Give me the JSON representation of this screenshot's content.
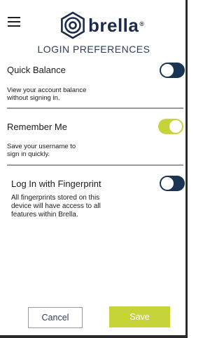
{
  "header": {
    "logo_text": "brella",
    "logo_tm": "®",
    "title": "LOGIN PREFERENCES"
  },
  "settings": [
    {
      "title": "Quick Balance",
      "description_lines": [
        "View your account balance",
        "without signing in."
      ],
      "enabled": false
    },
    {
      "title": "Remember Me",
      "description_lines": [
        "Save your username to",
        "sign in quickly."
      ],
      "enabled": true
    },
    {
      "title": "Log In with Fingerprint",
      "description_lines": [
        "All fingerprints stored on this",
        "device will have access to all",
        "features within Brella."
      ],
      "enabled": false
    }
  ],
  "buttons": {
    "cancel_label": "Cancel",
    "save_label": "Save"
  },
  "colors": {
    "accent": "#c6d43a",
    "toggle_off": "#1c3454",
    "brand_navy": "#1c2b4a"
  },
  "icons": {
    "menu": "hamburger-menu-icon",
    "logo": "brella-logo-icon"
  }
}
